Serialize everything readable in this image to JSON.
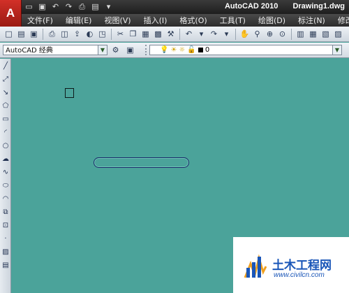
{
  "app": {
    "logo_letter": "A",
    "title": "AutoCAD 2010",
    "document": "Drawing1.dwg"
  },
  "quick_access": [
    "new-icon",
    "save-icon",
    "undo-icon",
    "redo-icon",
    "print-icon",
    "open-icon",
    "dropdown-icon"
  ],
  "menu": [
    "文件(F)",
    "编辑(E)",
    "视图(V)",
    "插入(I)",
    "格式(O)",
    "工具(T)",
    "绘图(D)",
    "标注(N)",
    "修改(M)"
  ],
  "toolbar2": {
    "workspace": "AutoCAD 经典",
    "layer_value": "0"
  },
  "watermark": {
    "title": "土木工程网",
    "url": "www.civilcn.com"
  },
  "colors": {
    "canvas": "#4ba39a",
    "watermark_blue": "#1a56b8"
  }
}
